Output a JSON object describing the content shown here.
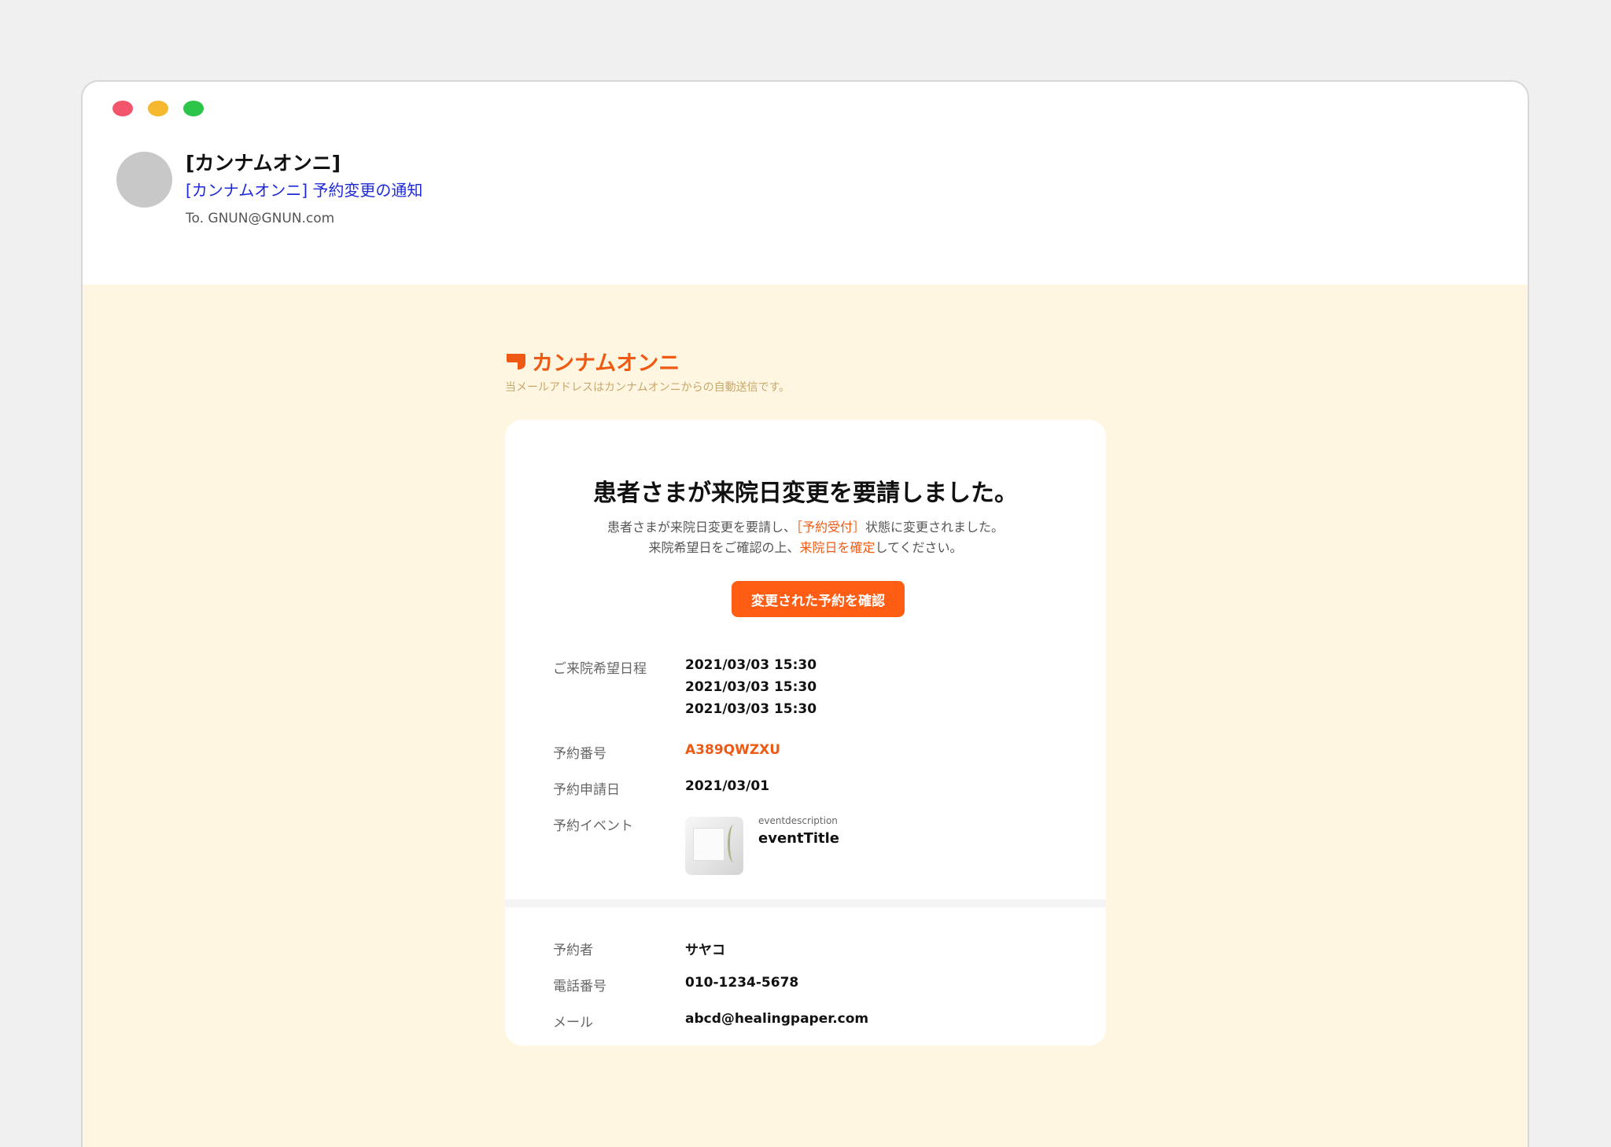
{
  "mail": {
    "sender": "[カンナムオンニ]",
    "subject": "[カンナムオンニ] 予約変更の通知",
    "to": "To. GNUN@GNUN.com"
  },
  "brand": {
    "name": "カンナムオンニ",
    "logo_icon": "speech-bubble-logo-icon",
    "color": "#ee5a14",
    "auto_note": "当メールアドレスはカンナムオンニからの自動送信です。"
  },
  "card": {
    "title": "患者さまが来院日変更を要請しました。",
    "desc_line1_pre": "患者さまが来院日変更を要請し、",
    "desc_line1_hl": "［予約受付］",
    "desc_line1_post": "状態に変更されました。",
    "desc_line2_pre": "来院希望日をご確認の上、",
    "desc_line2_hl": "来院日を確定",
    "desc_line2_post": "してください。",
    "button_label": "変更された予約を確認",
    "button_color": "#ff5c14"
  },
  "details": {
    "dates_label": "ご来院希望日程",
    "dates": [
      "2021/03/03 15:30",
      "2021/03/03 15:30",
      "2021/03/03 15:30"
    ],
    "reservation_no_label": "予約番号",
    "reservation_no": "A389QWZXU",
    "applied_label": "予約申請日",
    "applied_date": "2021/03/01",
    "event_label": "予約イベント",
    "event_description": "eventdescription",
    "event_title": "eventTitle"
  },
  "customer": {
    "name_label": "予約者",
    "name": "サヤコ",
    "phone_label": "電話番号",
    "phone": "010-1234-5678",
    "email_label": "メール",
    "email": "abcd@healingpaper.com"
  }
}
